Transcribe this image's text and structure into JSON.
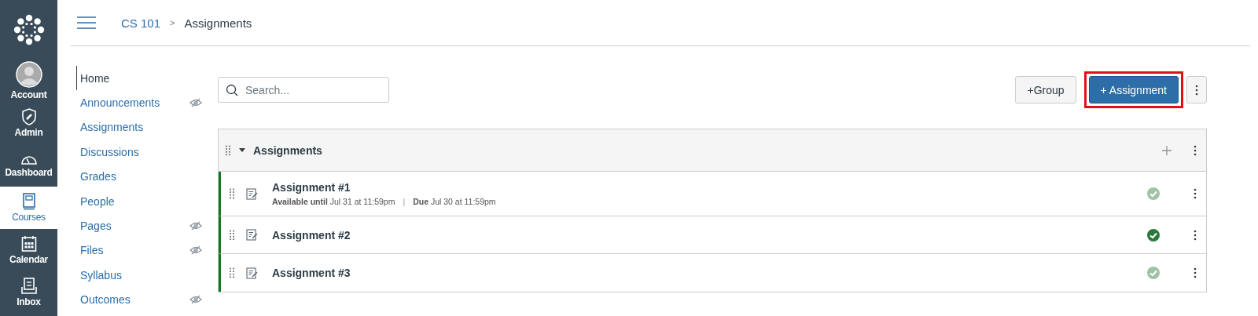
{
  "global_nav": [
    {
      "kind": "logo"
    },
    {
      "kind": "account",
      "label": "Account",
      "selected": false
    },
    {
      "kind": "admin",
      "label": "Admin",
      "selected": false
    },
    {
      "kind": "dashboard",
      "label": "Dashboard",
      "selected": false
    },
    {
      "kind": "courses",
      "label": "Courses",
      "selected": true
    },
    {
      "kind": "calendar",
      "label": "Calendar",
      "selected": false
    },
    {
      "kind": "inbox",
      "label": "Inbox",
      "selected": false
    }
  ],
  "breadcrumb": {
    "course": "CS 101",
    "separator": ">",
    "page": "Assignments"
  },
  "course_nav": [
    {
      "label": "Home",
      "selected": true,
      "hidden": false
    },
    {
      "label": "Announcements",
      "selected": false,
      "hidden": true
    },
    {
      "label": "Assignments",
      "selected": false,
      "hidden": false
    },
    {
      "label": "Discussions",
      "selected": false,
      "hidden": false
    },
    {
      "label": "Grades",
      "selected": false,
      "hidden": false
    },
    {
      "label": "People",
      "selected": false,
      "hidden": false
    },
    {
      "label": "Pages",
      "selected": false,
      "hidden": true
    },
    {
      "label": "Files",
      "selected": false,
      "hidden": true
    },
    {
      "label": "Syllabus",
      "selected": false,
      "hidden": false
    },
    {
      "label": "Outcomes",
      "selected": false,
      "hidden": true
    }
  ],
  "search": {
    "placeholder": "Search..."
  },
  "buttons": [
    {
      "kind": "secondary",
      "label": "+Group",
      "highlighted": false
    },
    {
      "kind": "primary",
      "label": "+ Assignment",
      "highlighted": true
    }
  ],
  "group": {
    "title": "Assignments",
    "expanded": true,
    "items": [
      {
        "title": "Assignment #1",
        "details": [
          "**Available until** Jul 31 at 11:59pm",
          "**Due** Jul 30 at 11:59pm"
        ],
        "separator": "|",
        "published_dark": false
      },
      {
        "title": "Assignment #2",
        "published_dark": true
      },
      {
        "title": "Assignment #3",
        "published_dark": false
      }
    ]
  }
}
